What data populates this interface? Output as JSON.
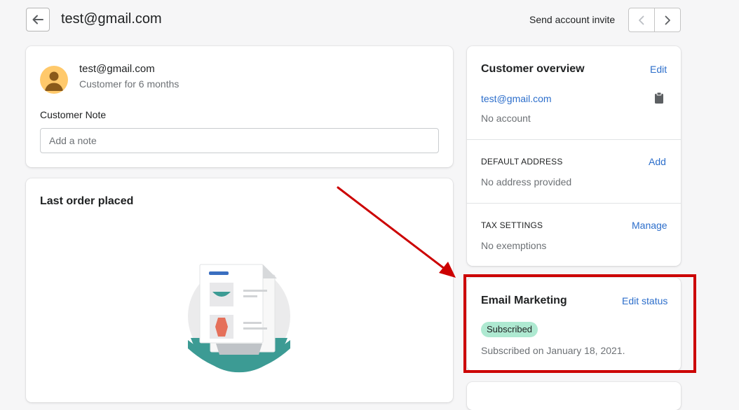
{
  "header": {
    "title": "test@gmail.com",
    "send_invite": "Send account invite"
  },
  "customer_card": {
    "email": "test@gmail.com",
    "customer_since": "Customer for 6 months",
    "note_label": "Customer Note",
    "note_placeholder": "Add a note",
    "note_value": ""
  },
  "last_order": {
    "title": "Last order placed"
  },
  "overview": {
    "title": "Customer overview",
    "edit": "Edit",
    "email": "test@gmail.com",
    "account_status": "No account",
    "default_address": {
      "heading": "DEFAULT ADDRESS",
      "action": "Add",
      "value": "No address provided"
    },
    "tax_settings": {
      "heading": "TAX SETTINGS",
      "action": "Manage",
      "value": "No exemptions"
    }
  },
  "email_marketing": {
    "title": "Email Marketing",
    "action": "Edit status",
    "badge": "Subscribed",
    "subscribed_on": "Subscribed on January 18, 2021."
  },
  "colors": {
    "link": "#2c6ecb",
    "badge_bg": "#aee9d1",
    "annotation": "#cc0000",
    "avatar": "#ffc96b"
  }
}
